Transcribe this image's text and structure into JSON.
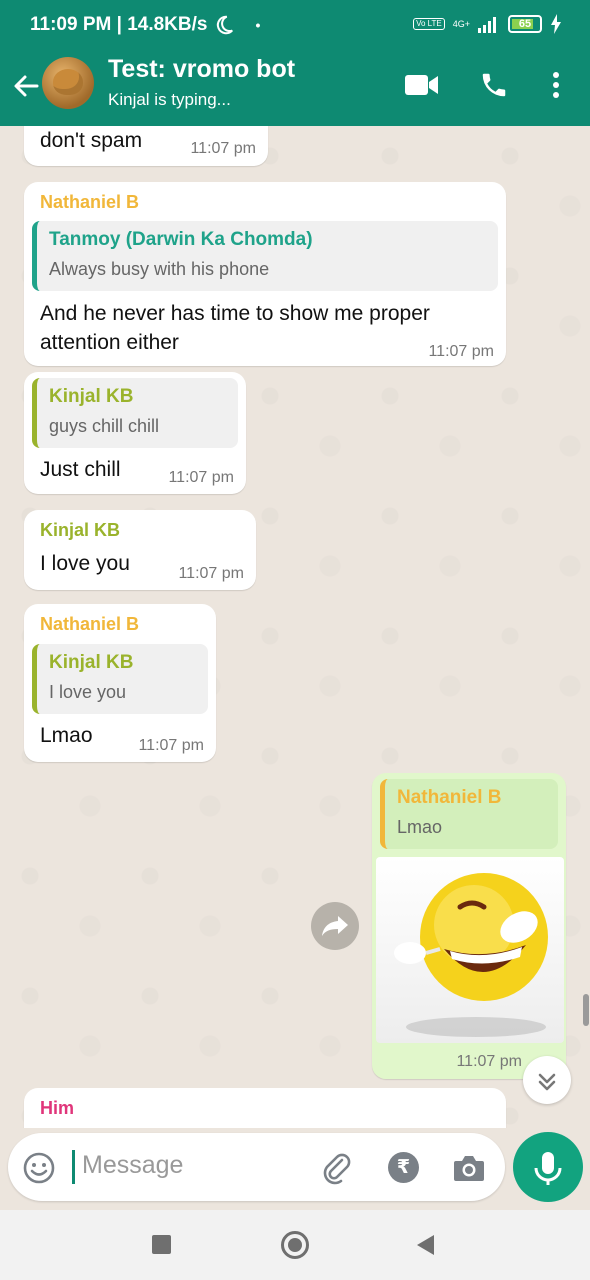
{
  "status_bar": {
    "time_speed": "11:09 PM | 14.8KB/s",
    "volte": "Vo LTE",
    "network": "4G+",
    "battery": "65"
  },
  "header": {
    "title": "Test: vromo bot",
    "subtitle": "Kinjal is typing..."
  },
  "messages": [
    {
      "text": "don't spam",
      "time": "11:07 pm"
    },
    {
      "sender": "Nathaniel B",
      "quote_name": "Tanmoy (Darwin Ka Chomda)",
      "quote_text": "Always busy with his phone",
      "text_line1": "And he never has time to show me proper",
      "text_line2": "attention either",
      "time": "11:07 pm"
    },
    {
      "quote_name": "Kinjal KB",
      "quote_text": "guys chill chill",
      "text": "Just chill",
      "time": "11:07 pm"
    },
    {
      "sender": "Kinjal KB",
      "text": "I  love you",
      "time": "11:07 pm"
    },
    {
      "sender": "Nathaniel B",
      "quote_name": "Kinjal KB",
      "quote_text": "I  love you",
      "text": "Lmao",
      "time": "11:07 pm"
    },
    {
      "quote_name": "Nathaniel B",
      "quote_text": "Lmao",
      "time": "11:07 pm"
    },
    {
      "sender": "Him"
    }
  ],
  "input": {
    "placeholder": "Message"
  },
  "colors": {
    "header": "#0e8a72",
    "nathaniel": "#f1b73a",
    "kinjal": "#9ab32c",
    "tanmoy": "#1fa38a",
    "him": "#e0357a"
  }
}
